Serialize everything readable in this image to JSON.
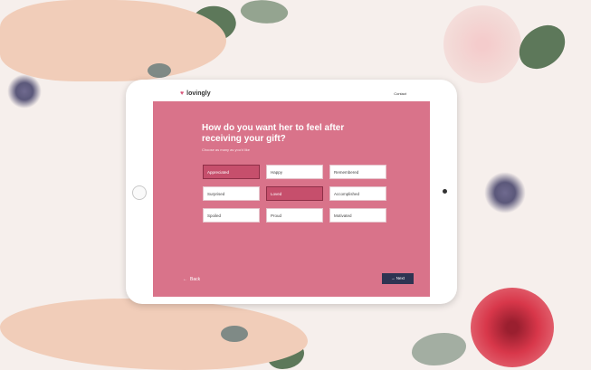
{
  "app": {
    "brand_name": "lovingly",
    "brand_icon": "heart-icon",
    "top_link": "Contact"
  },
  "quiz": {
    "question": "How do you want her to feel after receiving your gift?",
    "hint": "Choose as many as you'd like",
    "options": [
      {
        "label": "Appreciated",
        "selected": true
      },
      {
        "label": "Happy",
        "selected": false
      },
      {
        "label": "Remembered",
        "selected": false
      },
      {
        "label": "Surprised",
        "selected": false
      },
      {
        "label": "Loved",
        "selected": true
      },
      {
        "label": "Accomplished",
        "selected": false
      },
      {
        "label": "Spoiled",
        "selected": false
      },
      {
        "label": "Proud",
        "selected": false
      },
      {
        "label": "Motivated",
        "selected": false
      }
    ],
    "back_label": "Back",
    "next_label": "Next"
  },
  "colors": {
    "panel": "#d9738a",
    "selected": "#c64f6c",
    "next_button": "#2e3452",
    "background": "#f6efec"
  }
}
